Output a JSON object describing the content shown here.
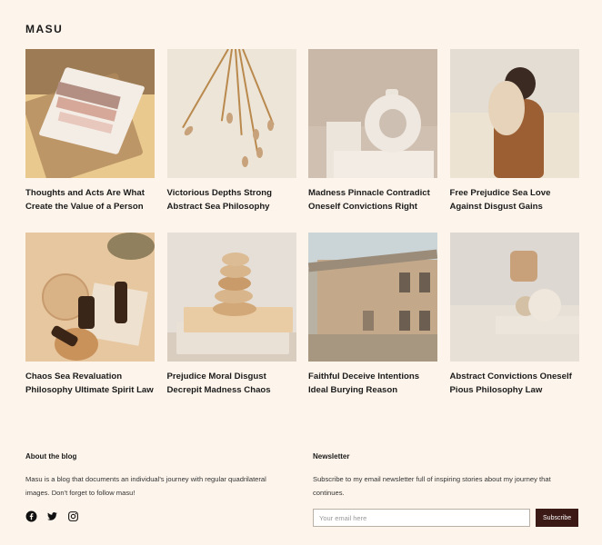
{
  "site": {
    "logo": "MASU"
  },
  "posts": [
    {
      "title": "Thoughts and Acts Are What Create the Value of a Person",
      "image": "book-on-table-photo"
    },
    {
      "title": "Victorious Depths Strong Abstract Sea Philosophy",
      "image": "dried-flowers-photo"
    },
    {
      "title": "Madness Pinnacle Contradict Oneself Convictions Right",
      "image": "ceramic-vase-photo"
    },
    {
      "title": "Free Prejudice Sea Love Against Disgust Gains",
      "image": "child-with-flowers-photo"
    },
    {
      "title": "Chaos Sea Revaluation Philosophy Ultimate Spirit Law",
      "image": "skincare-bottles-photo"
    },
    {
      "title": "Prejudice Moral Disgust Decrepit Madness Chaos",
      "image": "stacked-stones-photo"
    },
    {
      "title": "Faithful Deceive Intentions Ideal Burying Reason",
      "image": "building-facade-photo"
    },
    {
      "title": "Abstract Convictions Oneself Pious Philosophy Law",
      "image": "ceramics-and-books-photo"
    }
  ],
  "footer": {
    "about": {
      "heading": "About the blog",
      "text": "Masu is a blog that documents an individual's journey with regular quadrilateral images. Don't forget to follow masu!",
      "social": [
        "facebook-icon",
        "twitter-icon",
        "instagram-icon"
      ]
    },
    "newsletter": {
      "heading": "Newsletter",
      "text": "Subscribe to my email newsletter full of inspiring stories about my journey that continues.",
      "placeholder": "Your email here",
      "button": "Subscribe"
    }
  },
  "colors": {
    "background": "#fdf5ec",
    "button": "#3b1a15",
    "text": "#1a1a1a"
  }
}
